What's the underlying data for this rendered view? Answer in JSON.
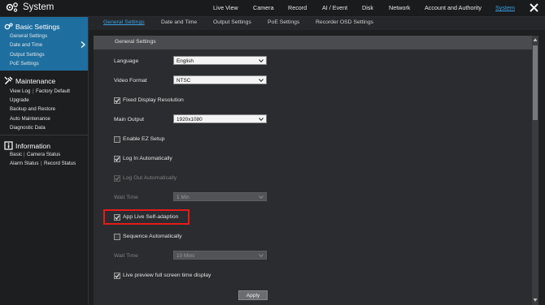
{
  "app": {
    "title": "System"
  },
  "top_nav": {
    "items": [
      {
        "label": "Live View"
      },
      {
        "label": "Camera"
      },
      {
        "label": "Record"
      },
      {
        "label": "AI / Event"
      },
      {
        "label": "Disk"
      },
      {
        "label": "Network"
      },
      {
        "label": "Account and Authority"
      },
      {
        "label": "System"
      }
    ],
    "active": "System"
  },
  "sidebar": {
    "basic": {
      "title": "Basic Settings",
      "items": [
        {
          "label": "General Settings"
        },
        {
          "label": "Date and Time"
        },
        {
          "label": "Output Settings"
        },
        {
          "label": "PoE Settings"
        }
      ]
    },
    "maintenance": {
      "title": "Maintenance",
      "items": [
        {
          "label": "View Log"
        },
        {
          "label": "Factory Default"
        },
        {
          "label": "Upgrade"
        },
        {
          "label": "Backup and Restore"
        },
        {
          "label": "Auto Maintenance"
        },
        {
          "label": "Diagnostic Data"
        }
      ]
    },
    "information": {
      "title": "Information",
      "items": [
        {
          "label": "Basic"
        },
        {
          "label": "Camera Status"
        },
        {
          "label": "Alarm Status"
        },
        {
          "label": "Record Status"
        }
      ]
    }
  },
  "tabs": [
    {
      "label": "General Settings",
      "active": true
    },
    {
      "label": "Date and Time"
    },
    {
      "label": "Output Settings"
    },
    {
      "label": "PoE Settings"
    },
    {
      "label": "Recorder OSD Settings"
    }
  ],
  "form": {
    "section_title": "General Settings",
    "language": {
      "label": "Language",
      "value": "English"
    },
    "video_format": {
      "label": "Video Format",
      "value": "NTSC"
    },
    "fixed_display_resolution": {
      "label": "Fixed Display Resolution",
      "checked": true
    },
    "main_output": {
      "label": "Main Output",
      "value": "1920x1080"
    },
    "enable_ez_setup": {
      "label": "Enable EZ Setup",
      "checked": false
    },
    "log_in_automatically": {
      "label": "Log In Automatically",
      "checked": true
    },
    "log_out_automatically": {
      "label": "Log Out Automatically",
      "checked": true,
      "disabled": true
    },
    "wait_time_1": {
      "label": "Wait Time",
      "value": "1 Min",
      "disabled": true
    },
    "app_live_self_adaption": {
      "label": "App Live Self-adaption",
      "checked": true,
      "highlighted": true
    },
    "sequence_automatically": {
      "label": "Sequence Automatically",
      "checked": false
    },
    "wait_time_2": {
      "label": "Wait Time",
      "value": "10 Mins",
      "disabled": true
    },
    "live_preview_full_screen_time": {
      "label": "Live preview full screen time display",
      "checked": true
    },
    "apply_label": "Apply"
  },
  "colors": {
    "accent": "#38a3e8",
    "sidebar_active": "#1e6fa0",
    "highlight_box": "#e41b1b",
    "background": "#1e1f21"
  },
  "icons": {
    "app": "gear-icon",
    "close": "close-icon",
    "maintenance": "wrench-icon",
    "information": "info-icon",
    "expand": "chevron-right-icon"
  }
}
